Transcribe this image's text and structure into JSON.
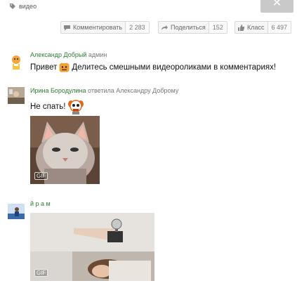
{
  "tag": {
    "label": "видео",
    "icon": "tag-icon"
  },
  "close": {
    "label": "✕"
  },
  "actions": {
    "comment": {
      "label": "Комментировать",
      "count": "2 283"
    },
    "share": {
      "label": "Поделиться",
      "count": "152"
    },
    "like": {
      "label": "Класс",
      "count": "6 497"
    }
  },
  "comments": [
    {
      "author": "Александр Добрый",
      "role": "админ",
      "text_before": "Привет",
      "text_after": "Делитесь смешными видеороликами в комментариях!"
    },
    {
      "author": "Ирина Бородулина",
      "reply_to": "ответила Александру Доброму",
      "text": "Не спать!",
      "gif_badge": "GIF"
    },
    {
      "author": "й р а м",
      "gif_badge": "GIF"
    }
  ],
  "colors": {
    "author": "#2e7d32",
    "button_bg": "#f6f6f6",
    "close_bg": "#c9c9c9"
  }
}
